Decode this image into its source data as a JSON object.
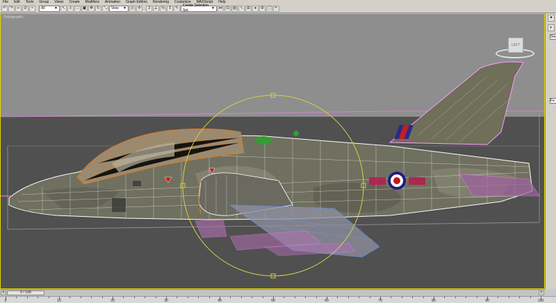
{
  "menu": [
    "File",
    "Edit",
    "Tools",
    "Group",
    "Views",
    "Create",
    "Modifiers",
    "Animation",
    "Graph Editors",
    "Rendering",
    "Customize",
    "MAXScript",
    "Help"
  ],
  "toolbar": {
    "filter_value": "All",
    "refcoord_value": "View",
    "selection_set_placeholder": "Create Selection Set"
  },
  "viewport": {
    "label": "Orthographic",
    "viewcube_label": "LEFT"
  },
  "command_panel": {
    "field1": "Sta",
    "field2": "Fa"
  },
  "timeslider": {
    "frame_readout": "0 / 100",
    "left_arrow": "<",
    "right_arrow": ">"
  },
  "trackbar": {
    "ticks": [
      "0",
      "10",
      "20",
      "30",
      "40",
      "50",
      "60",
      "70",
      "80",
      "90",
      "100"
    ]
  },
  "colors": {
    "viewport_border": "#e8d800",
    "gizmo_ring": "#d8d040",
    "wire_white": "#ffffff",
    "wire_orange": "#e07a20",
    "wire_pink": "#ff80ff",
    "wire_blue": "#6aa0ff"
  }
}
